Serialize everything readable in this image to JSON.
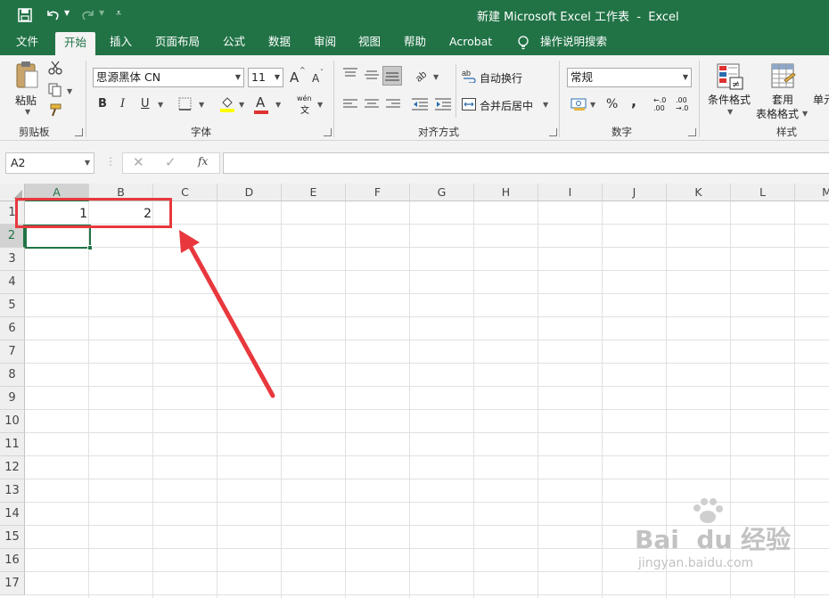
{
  "window": {
    "title": "新建 Microsoft Excel 工作表  -  Excel"
  },
  "tabs": [
    "文件",
    "开始",
    "插入",
    "页面布局",
    "公式",
    "数据",
    "审阅",
    "视图",
    "帮助",
    "Acrobat"
  ],
  "active_tab": "开始",
  "tell_me": "操作说明搜索",
  "ribbon": {
    "clipboard": {
      "paste": "粘贴",
      "label": "剪贴板"
    },
    "font": {
      "name": "思源黑体 CN",
      "size": "11",
      "grow": "A",
      "shrink": "A",
      "bold": "B",
      "italic": "I",
      "underline": "U",
      "font_color_icon": "A",
      "phonetic_top": "wén",
      "phonetic_bottom": "文",
      "label": "字体"
    },
    "alignment": {
      "wrap": "自动换行",
      "merge": "合并后居中",
      "label": "对齐方式"
    },
    "number": {
      "format": "常规",
      "percent": "%",
      "comma": ",",
      "inc_top": "←.0",
      "inc_bot": ".00",
      "dec_top": ".00",
      "dec_bot": "→.0",
      "label": "数字"
    },
    "styles": {
      "conditional": "条件格式",
      "table_top": "套用",
      "table_bottom": "表格格式",
      "cell_styles": "单元",
      "label": "样式"
    }
  },
  "formula_bar": {
    "name_box": "A2",
    "fx": "fx",
    "content": ""
  },
  "sheet": {
    "columns": [
      "A",
      "B",
      "C",
      "D",
      "E",
      "F",
      "G",
      "H",
      "I",
      "J",
      "K",
      "L",
      "M"
    ],
    "rows": [
      "1",
      "2",
      "3",
      "4",
      "5",
      "6",
      "7",
      "8",
      "9",
      "10",
      "11",
      "12",
      "13",
      "14",
      "15",
      "16",
      "17"
    ],
    "cells": {
      "A1": "1",
      "B1": "2"
    },
    "selected_cell": "A2"
  },
  "watermark": {
    "brand": "Bai  du 经验",
    "url": "jingyan.baidu.com"
  },
  "colors": {
    "excel_green": "#217346",
    "annotation_red": "#e8383d"
  }
}
